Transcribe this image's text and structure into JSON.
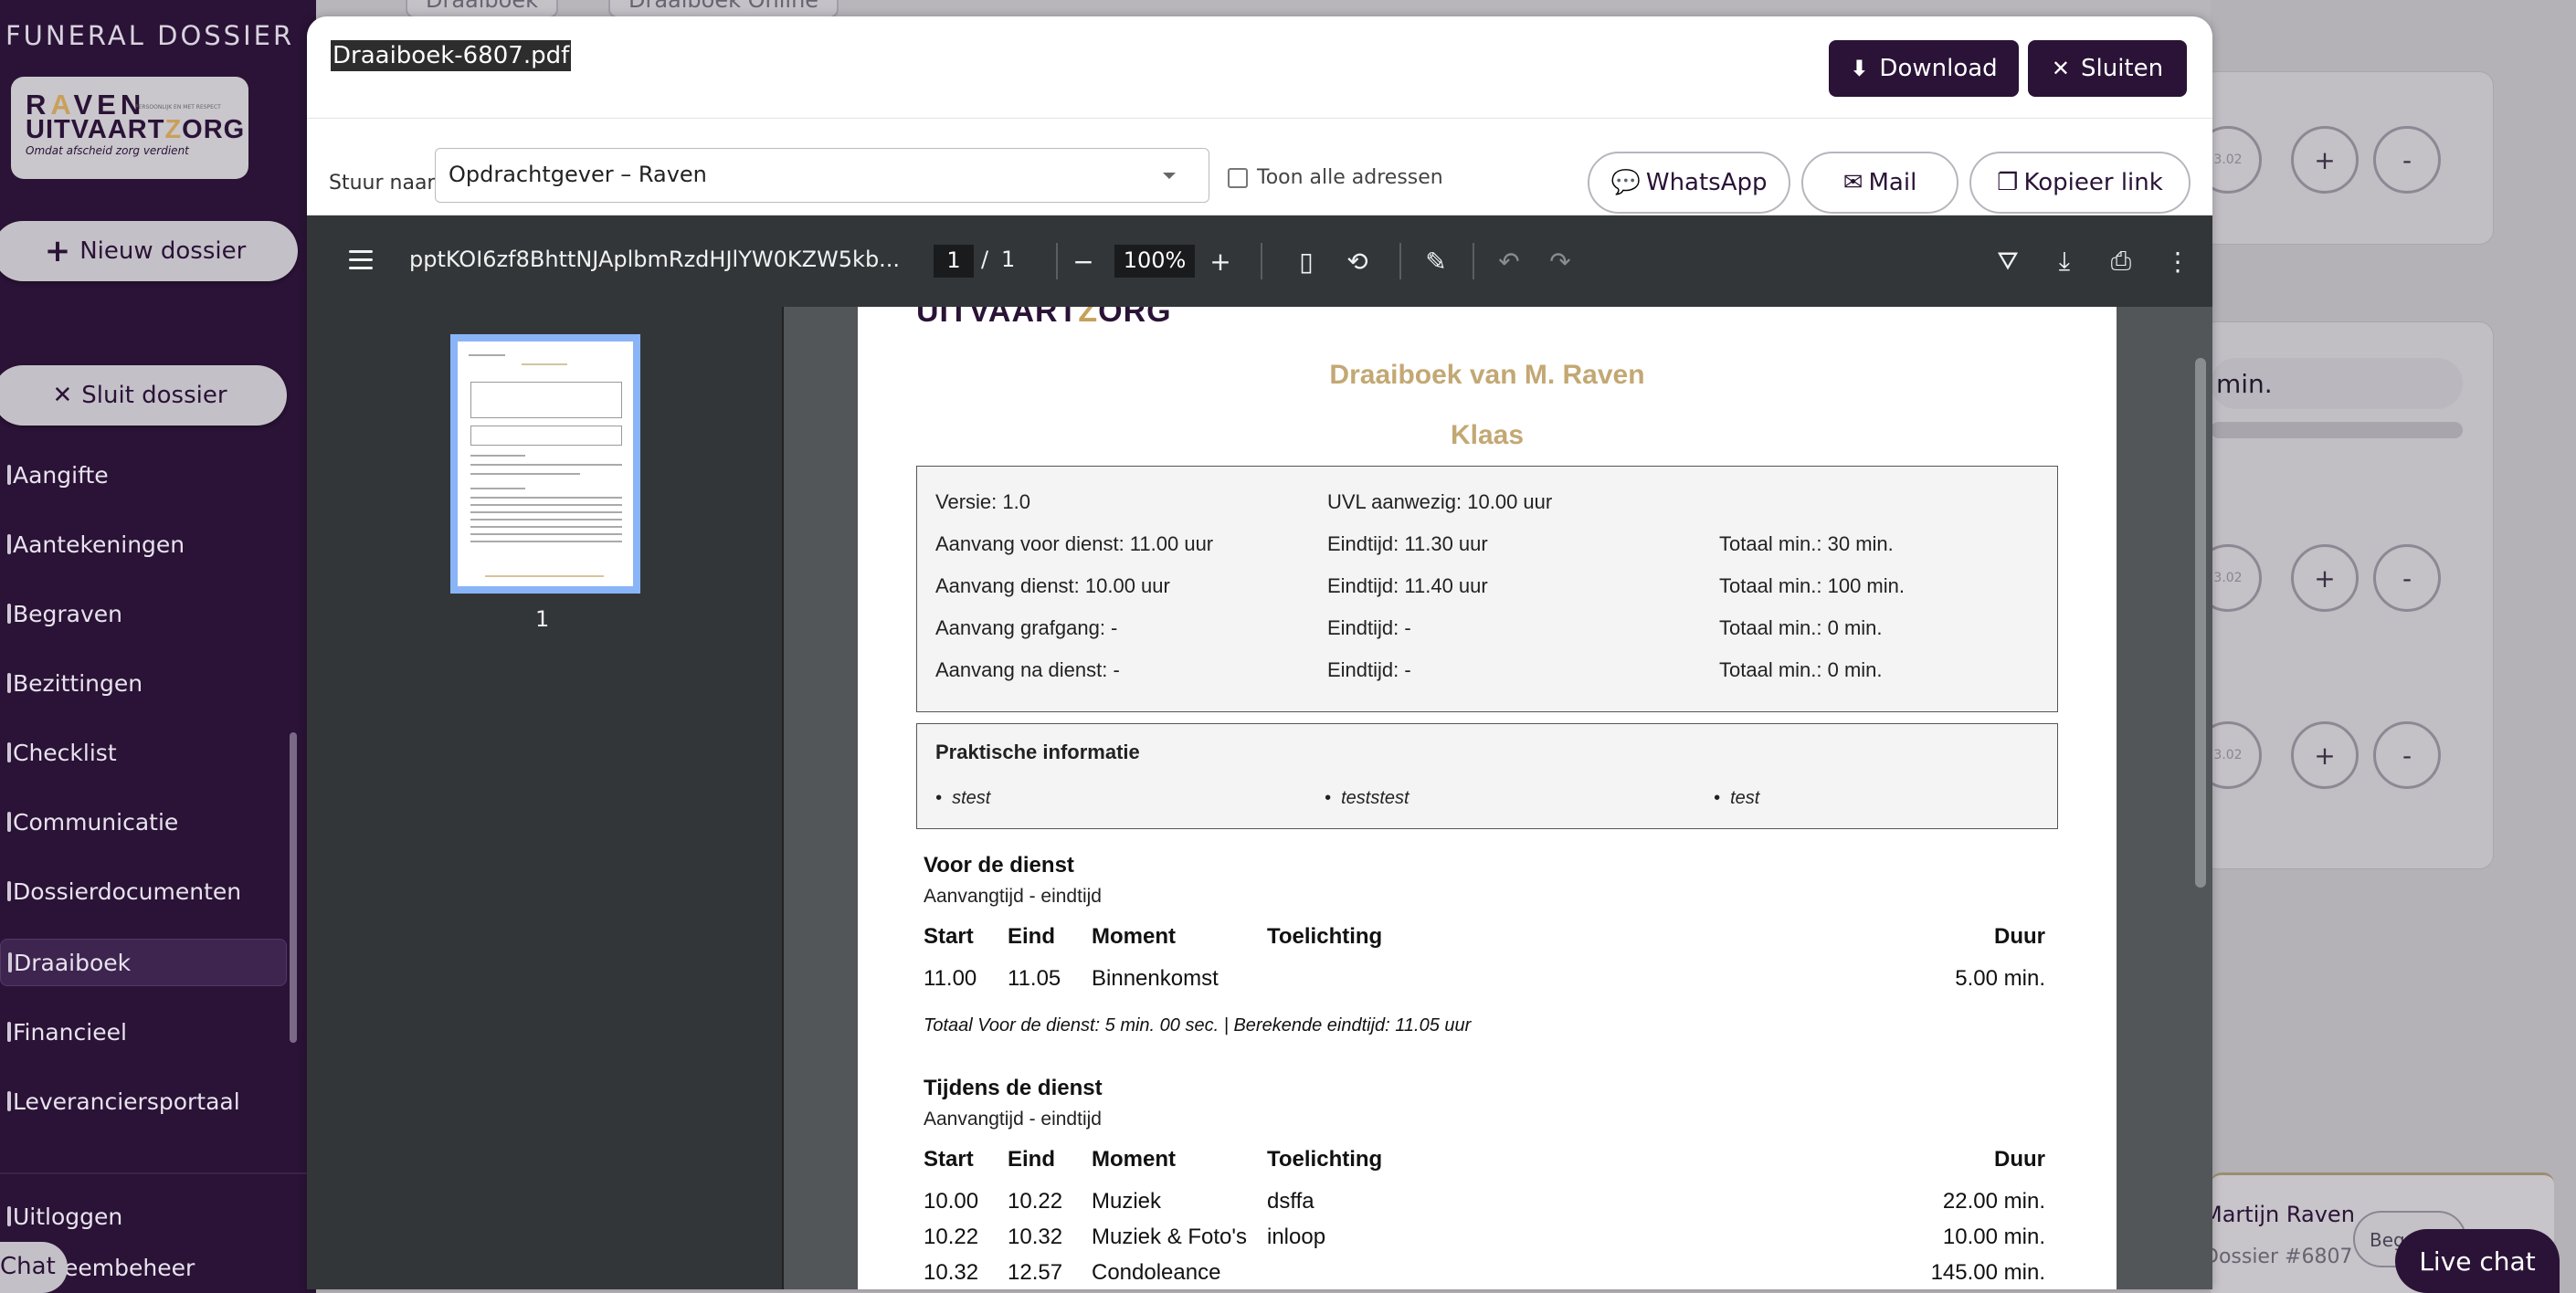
{
  "sidebar": {
    "brand": "FUNERAL DOSSIER",
    "logo": {
      "line1_a": "R",
      "line1_accent": "A",
      "line1_b": "VEN",
      "line2_a": "UITVAART",
      "line2_accent": "Z",
      "line2_b": "ORG",
      "tagline": "Omdat afscheid zorg verdient",
      "small": "PERSOONLIJK EN MET RESPECT"
    },
    "new_dossier": "Nieuw dossier",
    "close_dossier": "Sluit dossier",
    "items": [
      {
        "label": "Aangifte"
      },
      {
        "label": "Aantekeningen"
      },
      {
        "label": "Begraven"
      },
      {
        "label": "Bezittingen"
      },
      {
        "label": "Checklist"
      },
      {
        "label": "Communicatie"
      },
      {
        "label": "Dossierdocumenten"
      },
      {
        "label": "Draaiboek"
      },
      {
        "label": "Financieel"
      },
      {
        "label": "Leveranciersportaal"
      }
    ],
    "logout": "Uitloggen",
    "beheer": "eembeheer",
    "chat": "Chat"
  },
  "background": {
    "tabs": [
      "Draaiboek",
      "Draaiboek Online"
    ],
    "min_label": "min.",
    "circle_value": "3.02",
    "plus": "+",
    "minus": "-",
    "user_name": "Martijn Raven",
    "dossier_no": "Dossier #6807",
    "begin_btn": "Begr",
    "live_chat": "Live chat"
  },
  "modal": {
    "filename": "Draaiboek-6807.pdf",
    "download": "Download",
    "close": "Sluiten",
    "send_to_label": "Stuur naar",
    "recipient": "Opdrachtgever – Raven",
    "show_all": "Toon alle adressen",
    "whatsapp": "WhatsApp",
    "mail": "Mail",
    "copy_link": "Kopieer link"
  },
  "viewer": {
    "doc_name": "pptKOI6zf8BhttNJAplbmRzdHJlYW0KZW5kb...",
    "page": "1",
    "slash": "/",
    "total_pages": "1",
    "zoom": "100%",
    "thumb_label": "1"
  },
  "pdf": {
    "logo_a": "UITVAART",
    "logo_accent": "Z",
    "logo_b": "ORG",
    "title": "Draaiboek van M. Raven",
    "subtitle": "Klaas",
    "info": {
      "versie": "Versie: 1.0",
      "uvl": "UVL aanwezig: 10.00 uur",
      "r1": [
        "Aanvang voor dienst: 11.00 uur",
        "Eindtijd: 11.30 uur",
        "Totaal min.: 30 min."
      ],
      "r2": [
        "Aanvang dienst: 10.00 uur",
        "Eindtijd: 11.40 uur",
        "Totaal min.: 100 min."
      ],
      "r3": [
        "Aanvang grafgang: -",
        "Eindtijd: -",
        "Totaal min.: 0 min."
      ],
      "r4": [
        "Aanvang na dienst: -",
        "Eindtijd: -",
        "Totaal min.: 0 min."
      ]
    },
    "prakt": {
      "title": "Praktische informatie",
      "items": [
        "stest",
        "teststest",
        "test"
      ]
    },
    "cols": {
      "start": "Start",
      "eind": "Eind",
      "moment": "Moment",
      "toelichting": "Toelichting",
      "duur": "Duur"
    },
    "sec1": {
      "title": "Voor de dienst",
      "sub": "Aanvangtijd - eindtijd",
      "rows": [
        {
          "start": "11.00",
          "eind": "11.05",
          "moment": "Binnenkomst",
          "toel": "",
          "duur": "5.00 min."
        }
      ],
      "total": "Totaal Voor de dienst: 5 min. 00 sec. | Berekende eindtijd: 11.05 uur"
    },
    "sec2": {
      "title": "Tijdens de dienst",
      "sub": "Aanvangtijd - eindtijd",
      "rows": [
        {
          "start": "10.00",
          "eind": "10.22",
          "moment": "Muziek",
          "toel": "dsffa",
          "duur": "22.00 min."
        },
        {
          "start": "10.22",
          "eind": "10.32",
          "moment": "Muziek & Foto's",
          "toel": "inloop",
          "duur": "10.00 min."
        },
        {
          "start": "10.32",
          "eind": "12.57",
          "moment": "Condoleance",
          "toel": "",
          "duur": "145.00 min."
        }
      ]
    }
  },
  "colors": {
    "brand": "#2a1336",
    "accent": "#c8a05a",
    "pdf_title": "#c3a874"
  }
}
